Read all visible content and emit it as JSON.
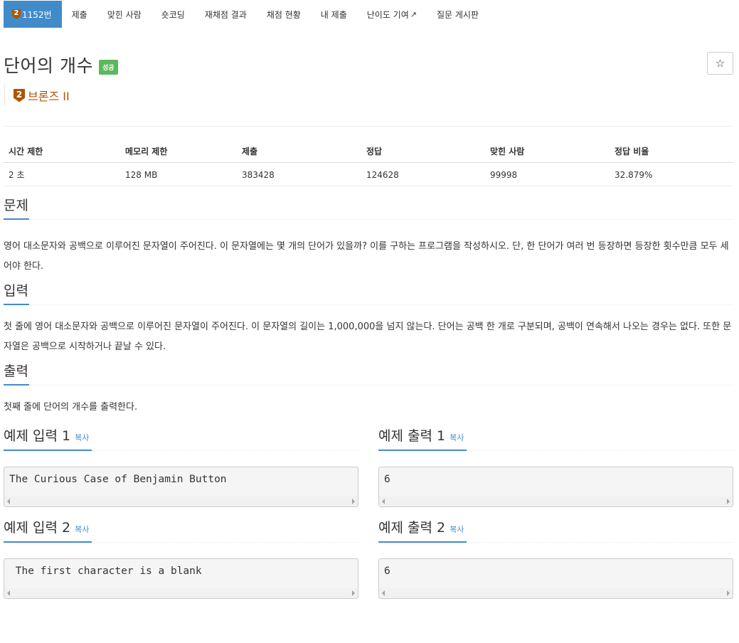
{
  "nav": {
    "tabs": [
      {
        "label": "1152번",
        "tier_digit": "2",
        "active": true
      },
      {
        "label": "제출"
      },
      {
        "label": "맞힌 사람"
      },
      {
        "label": "숏코딩"
      },
      {
        "label": "재채점 결과"
      },
      {
        "label": "채점 현황"
      },
      {
        "label": "내 제출"
      },
      {
        "label": "난이도 기여",
        "external": true
      },
      {
        "label": "질문 게시판"
      }
    ]
  },
  "problem": {
    "title": "단어의 개수",
    "status": "성공",
    "star_glyph": "☆",
    "tier_digit": "2",
    "tier_label": "브론즈 II"
  },
  "stats": {
    "headers": [
      "시간 제한",
      "메모리 제한",
      "제출",
      "정답",
      "맞힌 사람",
      "정답 비율"
    ],
    "values": [
      "2 초",
      "128 MB",
      "383428",
      "124628",
      "99998",
      "32.879%"
    ]
  },
  "sections": {
    "description": {
      "heading": "문제",
      "text": "영어 대소문자와 공백으로 이루어진 문자열이 주어진다. 이 문자열에는 몇 개의 단어가 있을까? 이를 구하는 프로그램을 작성하시오. 단, 한 단어가 여러 번 등장하면 등장한 횟수만큼 모두 세어야 한다."
    },
    "input": {
      "heading": "입력",
      "text": "첫 줄에 영어 대소문자와 공백으로 이루어진 문자열이 주어진다. 이 문자열의 길이는 1,000,000을 넘지 않는다. 단어는 공백 한 개로 구분되며, 공백이 연속해서 나오는 경우는 없다. 또한 문자열은 공백으로 시작하거나 끝날 수 있다."
    },
    "output": {
      "heading": "출력",
      "text": "첫째 줄에 단어의 개수를 출력한다."
    }
  },
  "samples": {
    "copy_label": "복사",
    "in1": {
      "heading": "예제 입력 1",
      "code": "The Curious Case of Benjamin Button"
    },
    "out1": {
      "heading": "예제 출력 1",
      "code": "6"
    },
    "in2": {
      "heading": "예제 입력 2",
      "code": " The first character is a blank"
    },
    "out2": {
      "heading": "예제 출력 2",
      "code": "6"
    }
  },
  "colors": {
    "primary": "#428bca",
    "success": "#5cb85c",
    "bronze": "#ad5600"
  }
}
